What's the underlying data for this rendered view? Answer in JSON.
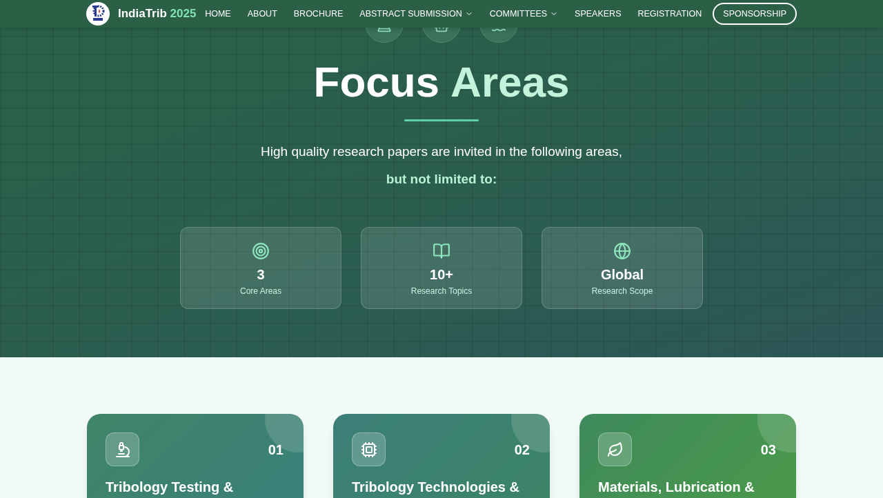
{
  "nav": {
    "brand": {
      "name": "IndiaTrib",
      "year": "2025"
    },
    "items": [
      {
        "label": "HOME",
        "kind": "link",
        "dropdown": false
      },
      {
        "label": "ABOUT",
        "kind": "link",
        "dropdown": false
      },
      {
        "label": "BROCHURE",
        "kind": "link",
        "dropdown": false
      },
      {
        "label": "ABSTRACT SUBMISSION",
        "kind": "link",
        "dropdown": true
      },
      {
        "label": "COMMITTEES",
        "kind": "link",
        "dropdown": true
      },
      {
        "label": "SPEAKERS",
        "kind": "link",
        "dropdown": false
      },
      {
        "label": "REGISTRATION",
        "kind": "link",
        "dropdown": false
      },
      {
        "label": "SPONSORSHIP",
        "kind": "outline",
        "dropdown": false
      }
    ]
  },
  "hero": {
    "title": {
      "plain": "Focus",
      "highlight": "Areas"
    },
    "intro": "High quality research papers are invited in the following areas,",
    "intro_emphasis": "but not limited to:",
    "stats": [
      {
        "value": "3",
        "label": "Core Areas"
      },
      {
        "value": "10+",
        "label": "Research Topics"
      },
      {
        "value": "Global",
        "label": "Research Scope"
      }
    ]
  },
  "areas": [
    {
      "number": "01",
      "title": "Tribology Testing &"
    },
    {
      "number": "02",
      "title": "Tribology Technologies &"
    },
    {
      "number": "03",
      "title": "Materials, Lubrication &"
    }
  ]
}
